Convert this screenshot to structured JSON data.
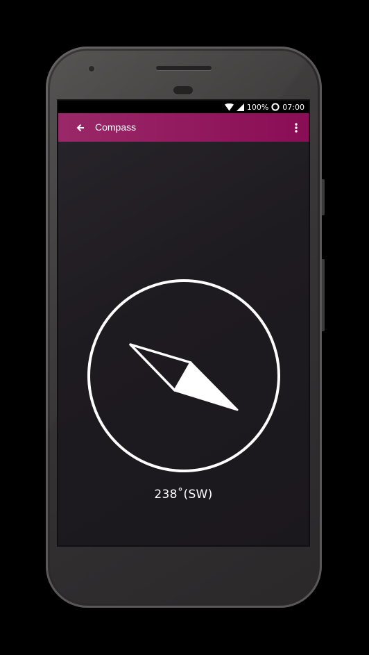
{
  "status_bar": {
    "battery": "100%",
    "time": "07:00",
    "icons": [
      "wifi-icon",
      "cell-signal-icon",
      "battery-icon"
    ]
  },
  "app_bar": {
    "title": "Compass",
    "back_icon": "arrow-back-icon",
    "menu_icon": "more-vert-icon",
    "color": "#8e1158"
  },
  "compass": {
    "bearing_deg": 238,
    "direction": "SW",
    "label": "238˚(SW)"
  },
  "colors": {
    "screen_background": "#1d1a1f",
    "dial": "#ffffff"
  }
}
